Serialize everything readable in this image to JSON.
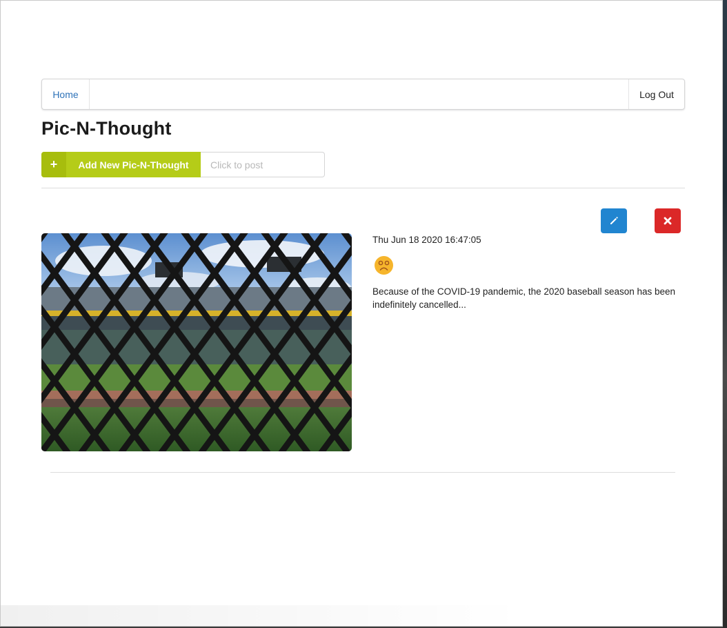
{
  "nav": {
    "home_label": "Home",
    "logout_label": "Log Out"
  },
  "page": {
    "title": "Pic-N-Thought"
  },
  "new_post": {
    "plus_icon": "+",
    "button_label": "Add New Pic-N-Thought",
    "input_placeholder": "Click to post",
    "input_value": ""
  },
  "post": {
    "date": "Thu Jun 18 2020 16:47:05",
    "mood_icon": "sad-face-icon",
    "text": "Because of the COVID-19 pandemic, the 2020 baseball season has been indefinitely cancelled..."
  },
  "colors": {
    "accent_olive": "#b5cc18",
    "edit_blue": "#2185d0",
    "delete_red": "#db2828",
    "link_blue": "#2e72b8",
    "mood_yellow": "#f6b52c"
  }
}
